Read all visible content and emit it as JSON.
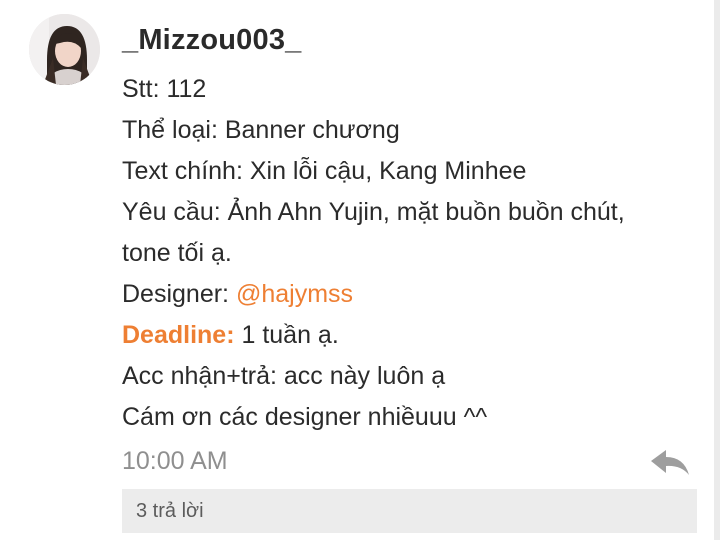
{
  "post": {
    "username": "_Mizzou003_",
    "lines": {
      "stt": "Stt: 112",
      "category": "Thể loại: Banner chương",
      "main_text": "Text chính: Xin lỗi cậu, Kang Minhee",
      "request_1": "Yêu cầu: Ảnh Ahn Yujin, mặt buồn buồn chút,",
      "request_2": "tone tối ạ.",
      "designer_label": "Designer: ",
      "designer_handle": "@hajymss",
      "deadline_label": "Deadline:",
      "deadline_value": " 1 tuần ạ.",
      "account": "Acc nhận+trả: acc này luôn ạ",
      "thanks": "Cám ơn các designer nhiềuuu ^^"
    },
    "timestamp": "10:00 AM",
    "replies_label": "3 trả lời"
  },
  "icons": {
    "avatar": "user-avatar-photo",
    "reply": "reply-arrow-icon"
  },
  "colors": {
    "accent": "#ee7f33",
    "text": "#2b2b2b",
    "muted": "#8f8f8f",
    "reply_bar": "#ececec",
    "page_background": "#ebebeb"
  }
}
